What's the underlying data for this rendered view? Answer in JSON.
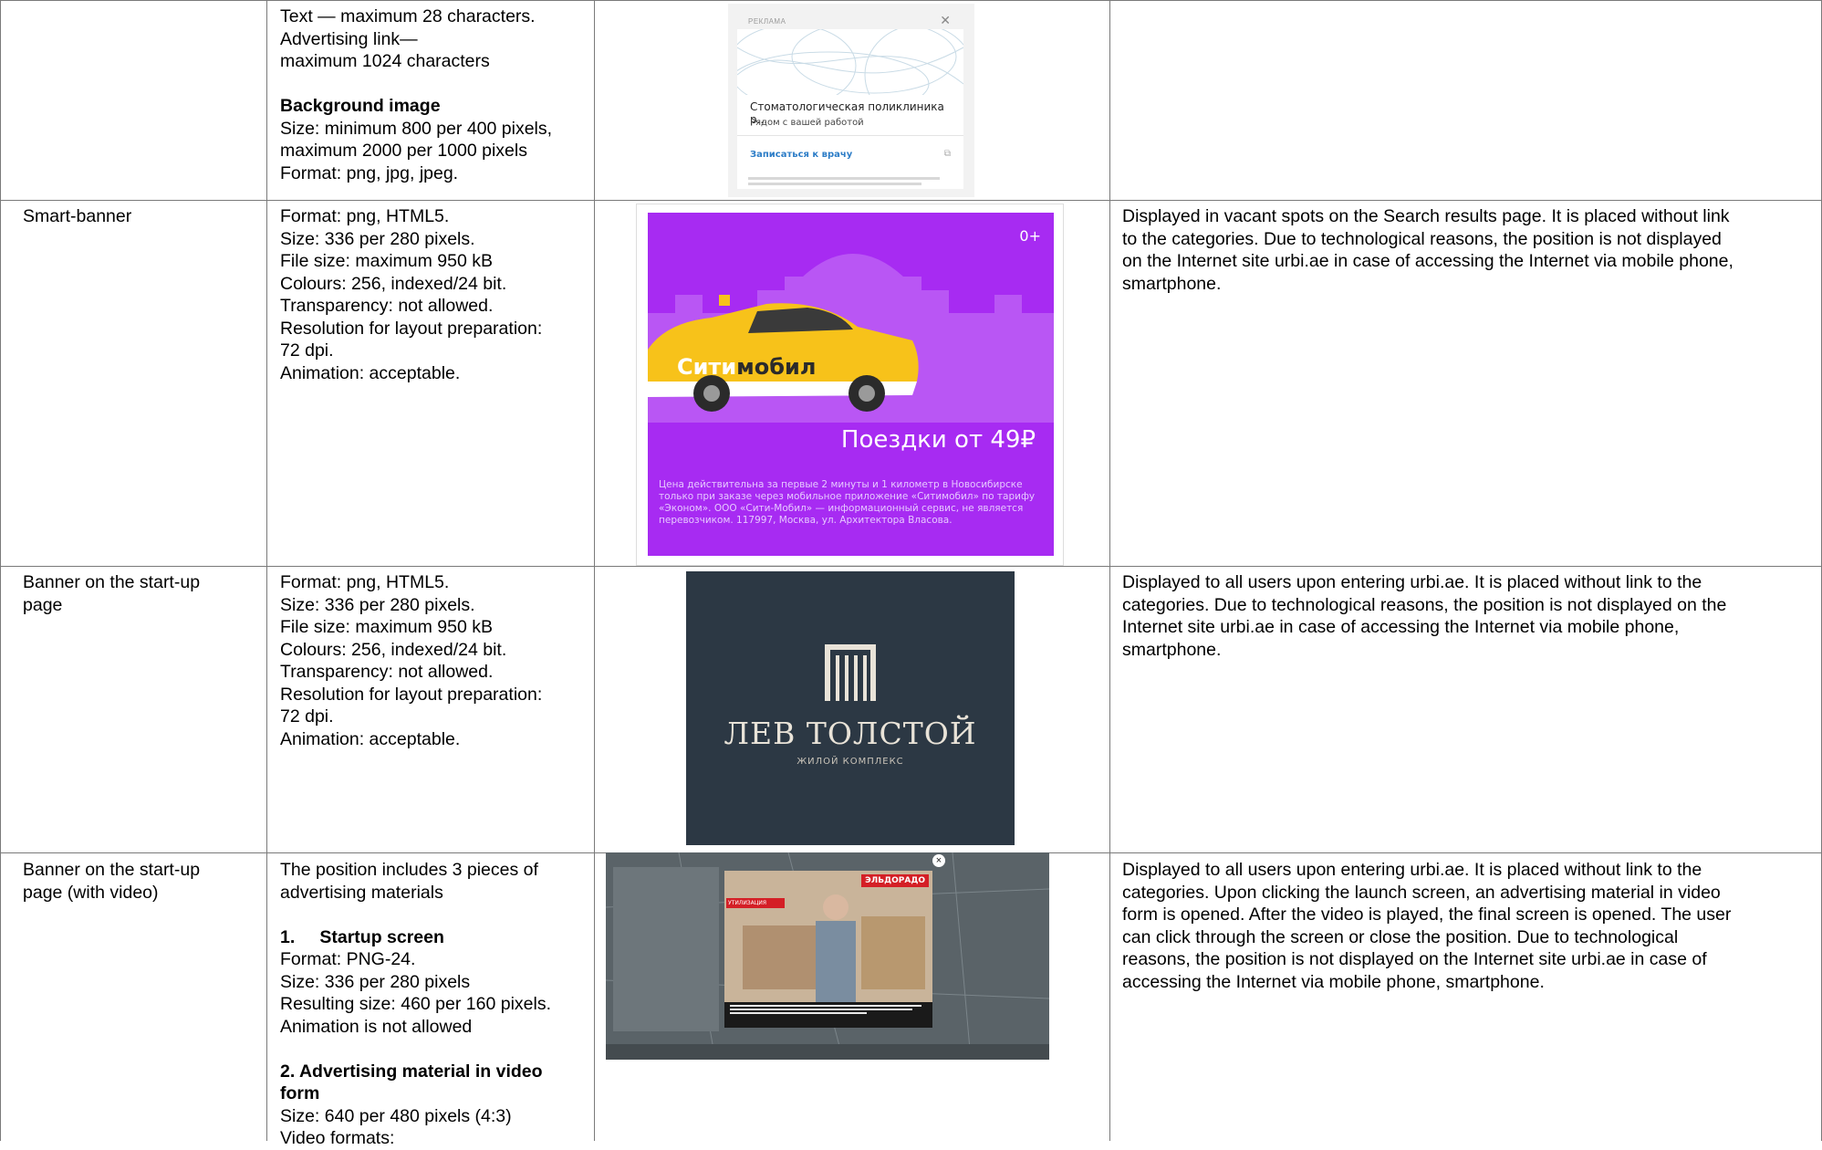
{
  "rows": [
    {
      "position": "",
      "format": [
        "Text — maximum 28 characters.",
        "Advertising link—",
        "maximum 1024 characters"
      ],
      "format_heading": "Background image",
      "format_after": [
        "Size: minimum 800 per 400 pixels,",
        "maximum 2000 per 1000 pixels",
        "Format: png, jpg, jpeg."
      ],
      "description": ""
    },
    {
      "position": "Smart-banner",
      "format": [
        "Format: png, HTML5.",
        "Size: 336 per 280 pixels.",
        "File size: maximum 950 kB",
        "Colours: 256, indexed/24 bit.",
        "Transparency: not allowed.",
        "Resolution for layout preparation:",
        "72 dpi.",
        "Animation: acceptable."
      ],
      "description": [
        "Displayed in vacant spots on the Search results page. It is placed without link",
        "to the categories. Due to technological reasons, the position is not displayed",
        "on the Internet site urbi.ae in case of accessing the Internet via mobile phone,",
        "smartphone."
      ]
    },
    {
      "position": [
        "Banner on the start-up",
        "page"
      ],
      "format": [
        "Format: png, HTML5.",
        "Size: 336 per 280 pixels.",
        "File size: maximum 950 kB",
        "Colours: 256, indexed/24 bit.",
        "Transparency: not allowed.",
        "Resolution for layout preparation:",
        "72 dpi.",
        "Animation: acceptable."
      ],
      "description": [
        "Displayed to all users upon entering urbi.ae. It is placed without link to the",
        "categories. Due to technological reasons, the position is not displayed on the",
        "Internet site urbi.ae in case of accessing the Internet via mobile phone,",
        "smartphone."
      ]
    },
    {
      "position": [
        "Banner on the start-up",
        "page (with video)"
      ],
      "format_intro": [
        "The position includes 3 pieces of",
        "advertising materials"
      ],
      "format_h1": "1.     Startup screen",
      "format_h1_lines": [
        "Format: PNG-24.",
        "Size: 336 per 280 pixels",
        "Resulting size: 460 per 160 pixels.",
        "Animation is not allowed"
      ],
      "format_h2": [
        "2. Advertising material in video",
        "form"
      ],
      "format_h2_lines": [
        "Size: 640 per 480 pixels (4:3)",
        "Video formats:"
      ],
      "description": [
        "Displayed to all users upon entering urbi.ae. It is placed without link to the",
        "categories. Upon clicking the launch screen, an advertising material in video",
        "form is opened. After the video is played, the final screen is opened. The user",
        "can click through the screen or close the position. Due to technological",
        "reasons, the position is not displayed on the Internet site urbi.ae in case of",
        "accessing the Internet via mobile phone, smartphone."
      ]
    }
  ],
  "ads": {
    "popup": {
      "header": "РЕКЛАМА",
      "close": "✕",
      "clinic": "Стоматологическая поликлиника р...",
      "subtitle": "Рядом с вашей работой",
      "cta": "Записаться к врачу"
    },
    "taxi": {
      "age": "0+",
      "brand_a": "Сити",
      "brand_b": "мобил",
      "ride": "Поездки от 49₽",
      "legal": "Цена действительна за первые 2 минуты и 1 километр в Новосибирске только при заказе через мобильное приложение «Ситимобил» по тарифу «Эконом». ООО «Сити-Мобил» — информационный сервис, не является перевозчиком. 117997, Москва, ул. Архитектора Власова.",
      "bg_color": "#a72bf2"
    },
    "tolstoy": {
      "name": "ЛЕВ ТОЛСТОЙ",
      "sub": "ЖИЛОЙ КОМПЛЕКС",
      "bg_color": "#2c3844"
    },
    "video": {
      "brand": "ЭЛЬДОРАДО",
      "badge": "УТИЛИЗАЦИЯ"
    }
  }
}
